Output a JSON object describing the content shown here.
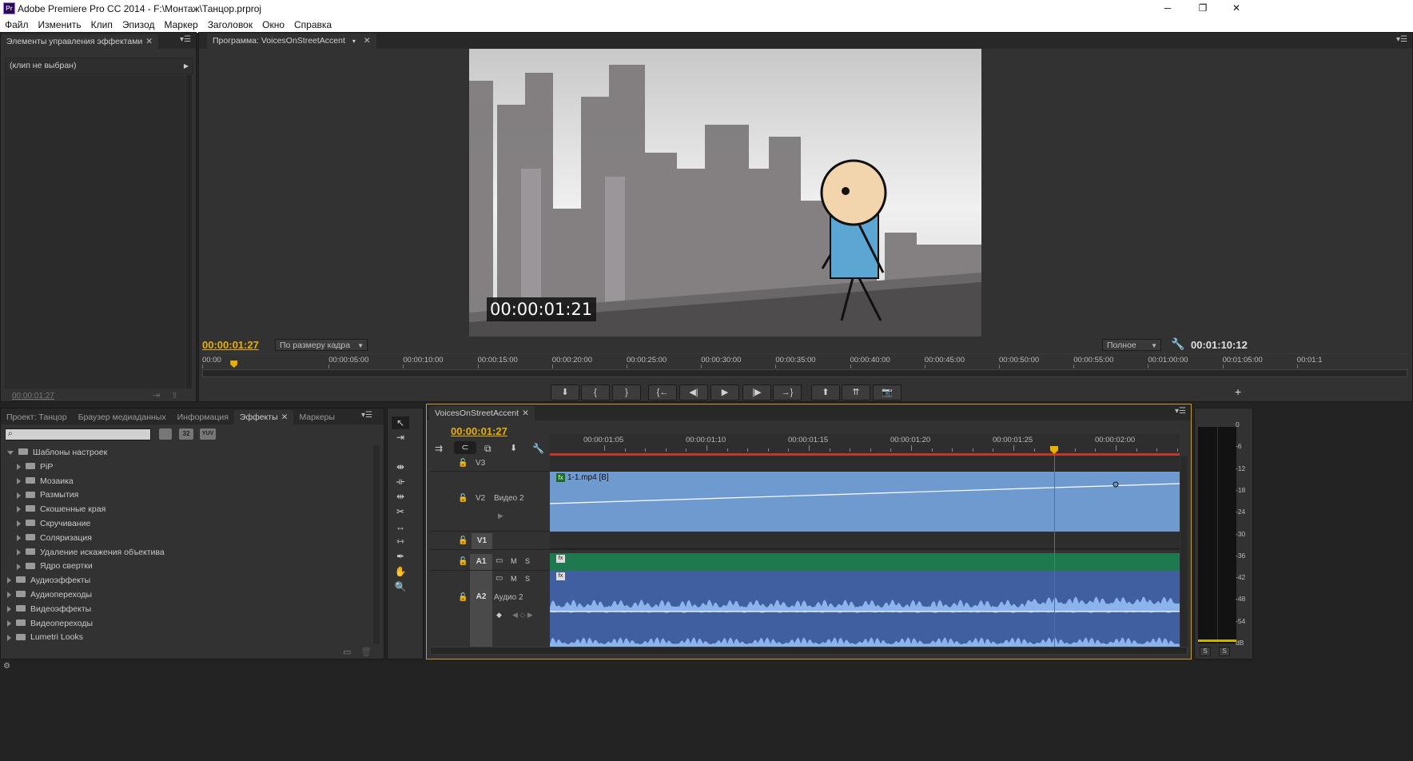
{
  "app": {
    "title": "Adobe Premiere Pro CC 2014 - F:\\Монтаж\\Танцор.prproj",
    "icon": "Pr"
  },
  "window_controls": {
    "minimize": "─",
    "maximize": "❐",
    "close": "✕"
  },
  "menu": [
    "Файл",
    "Изменить",
    "Клип",
    "Эпизод",
    "Маркер",
    "Заголовок",
    "Окно",
    "Справка"
  ],
  "effect_controls": {
    "tab": "Элементы управления эффектами",
    "no_clip": "(клип не выбран)",
    "timecode": "00:00:01:27"
  },
  "program_monitor": {
    "tab": "Программа: VoicesOnStreetAccent",
    "frame_timecode": "00:00:01:21",
    "current_timecode": "00:00:01:27",
    "fit": "По размеру кадра",
    "quality": "Полное",
    "duration": "00:01:10:12",
    "ruler": [
      "00:00",
      "00:00:05:00",
      "00:00:10:00",
      "00:00:15:00",
      "00:00:20:00",
      "00:00:25:00",
      "00:00:30:00",
      "00:00:35:00",
      "00:00:40:00",
      "00:00:45:00",
      "00:00:50:00",
      "00:00:55:00",
      "00:01:00:00",
      "00:01:05:00",
      "00:01:1"
    ],
    "playhead_fraction": 0.026,
    "buttons": [
      "marker-icon",
      "in-point-icon",
      "out-point-icon",
      "go-to-in-icon",
      "step-back-icon",
      "play-icon",
      "step-forward-icon",
      "go-to-out-icon",
      "lift-icon",
      "extract-icon",
      "export-frame-icon"
    ]
  },
  "project_panel": {
    "tabs": [
      "Проект: Танцор",
      "Браузер медиаданных",
      "Информация",
      "Эффекты",
      "Маркеры"
    ],
    "active_tab": "Эффекты",
    "search_placeholder": "",
    "filter_buttons": [
      "32",
      "YUV"
    ],
    "tree": [
      {
        "label": "Шаблоны настроек",
        "level": 0,
        "open": true
      },
      {
        "label": "PiP",
        "level": 1
      },
      {
        "label": "Мозаика",
        "level": 1
      },
      {
        "label": "Размытия",
        "level": 1
      },
      {
        "label": "Скошенные края",
        "level": 1
      },
      {
        "label": "Скручивание",
        "level": 1
      },
      {
        "label": "Соляризация",
        "level": 1
      },
      {
        "label": "Удаление искажения объектива",
        "level": 1
      },
      {
        "label": "Ядро свертки",
        "level": 1
      },
      {
        "label": "Аудиоэффекты",
        "level": 0
      },
      {
        "label": "Аудиопереходы",
        "level": 0
      },
      {
        "label": "Видеоэффекты",
        "level": 0
      },
      {
        "label": "Видеопереходы",
        "level": 0
      },
      {
        "label": "Lumetri Looks",
        "level": 0
      }
    ]
  },
  "timeline": {
    "tab": "VoicesOnStreetAccent",
    "timecode": "00:00:01:27",
    "ruler": [
      "00:00:01:05",
      "00:00:01:10",
      "00:00:01:15",
      "00:00:01:20",
      "00:00:01:25",
      "00:00:02:00"
    ],
    "tracks": {
      "v3": "V3",
      "v2": "V2",
      "v2_name": "Видео 2",
      "v1": "V1",
      "a1": "A1",
      "a2": "A2",
      "a2_name": "Аудио 2",
      "m": "M",
      "s": "S"
    },
    "clip_name": "1-1.mp4 [B]",
    "fx_badge": "fx",
    "colors": {
      "video_clip": "#6e9ad0",
      "audio1_clip": "#1e7a4e",
      "audio2_clip": "#3f5fa0",
      "playhead": "#e03a3a",
      "timecode": "#e8b100"
    }
  },
  "audio_meter": {
    "scale": [
      "0",
      "-6",
      "-12",
      "-18",
      "-24",
      "-30",
      "-36",
      "-42",
      "-48",
      "-54",
      "dB"
    ],
    "solo": [
      "S",
      "S"
    ]
  }
}
